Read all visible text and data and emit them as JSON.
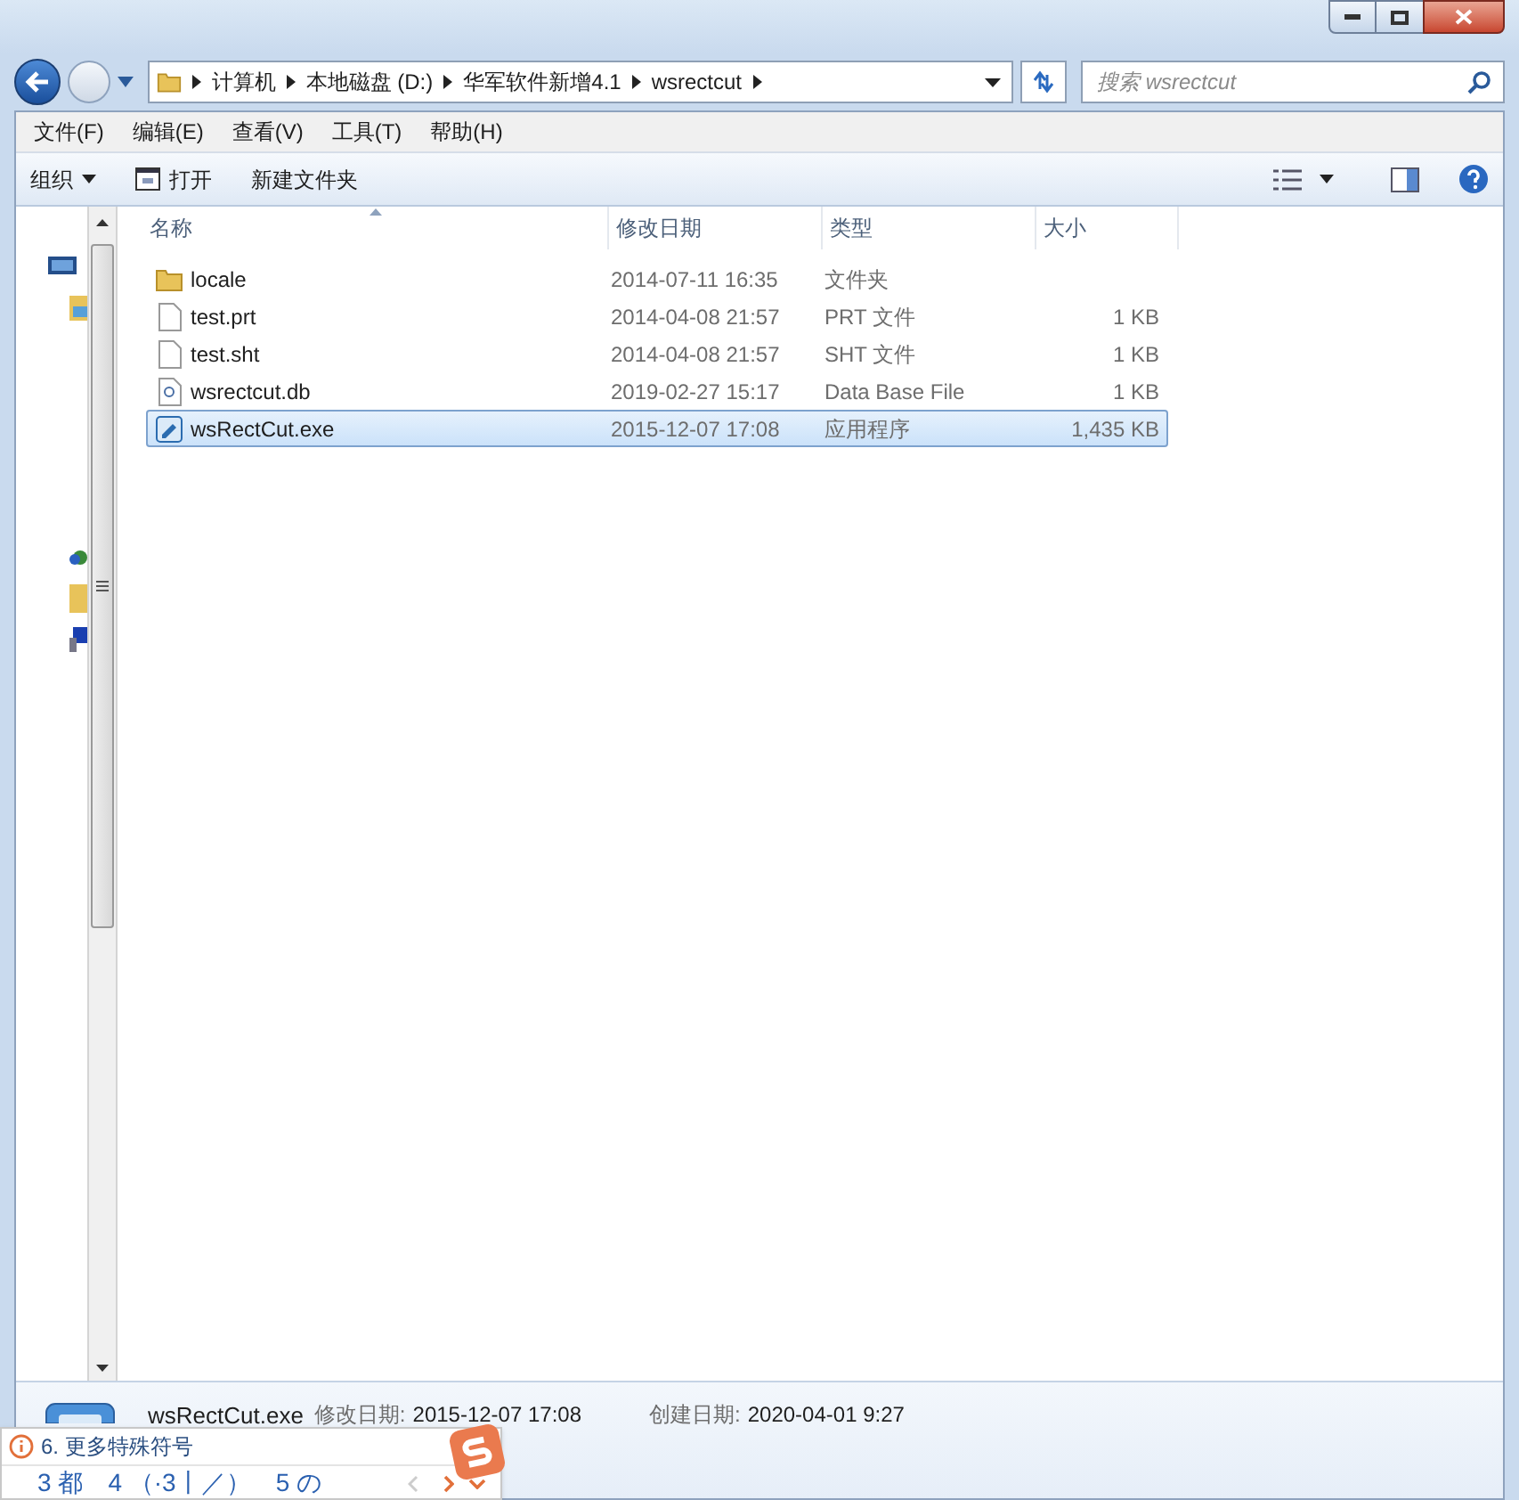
{
  "address": {
    "segments": [
      "计算机",
      "本地磁盘 (D:)",
      "华军软件新增4.1",
      "wsrectcut"
    ]
  },
  "search": {
    "placeholder": "搜索 wsrectcut"
  },
  "menu": [
    "文件(F)",
    "编辑(E)",
    "查看(V)",
    "工具(T)",
    "帮助(H)"
  ],
  "toolbar": [
    {
      "label": "组织",
      "kind": "dropdown"
    },
    {
      "label": "打开",
      "kind": "icon"
    },
    {
      "label": "新建文件夹",
      "kind": "plain"
    }
  ],
  "columns": [
    {
      "label": "名称",
      "sorted": true
    },
    {
      "label": "修改日期",
      "sorted": false
    },
    {
      "label": "类型",
      "sorted": false
    },
    {
      "label": "大小",
      "sorted": false
    }
  ],
  "rows": [
    {
      "name": "locale",
      "date": "2014-07-11 16:35",
      "type": "文件夹",
      "size": "",
      "kind": "folder",
      "selected": false
    },
    {
      "name": "test.prt",
      "date": "2014-04-08 21:57",
      "type": "PRT 文件",
      "size": "1 KB",
      "kind": "file",
      "selected": false
    },
    {
      "name": "test.sht",
      "date": "2014-04-08 21:57",
      "type": "SHT 文件",
      "size": "1 KB",
      "kind": "file",
      "selected": false
    },
    {
      "name": "wsrectcut.db",
      "date": "2019-02-27 15:17",
      "type": "Data Base File",
      "size": "1 KB",
      "kind": "data",
      "selected": false
    },
    {
      "name": "wsRectCut.exe",
      "date": "2015-12-07 17:08",
      "type": "应用程序",
      "size": "1,435 KB",
      "kind": "app",
      "selected": true
    }
  ],
  "details": {
    "name": "wsRectCut.exe",
    "modified_label": "修改日期:",
    "modified": "2015-12-07 17:08",
    "created_label": "创建日期:",
    "created": "2020-04-01 9:27"
  },
  "ime": {
    "hint": "6. 更多特殊符号",
    "candidates": [
      "3 都",
      "4 （·3丨／）",
      "5 の"
    ]
  }
}
